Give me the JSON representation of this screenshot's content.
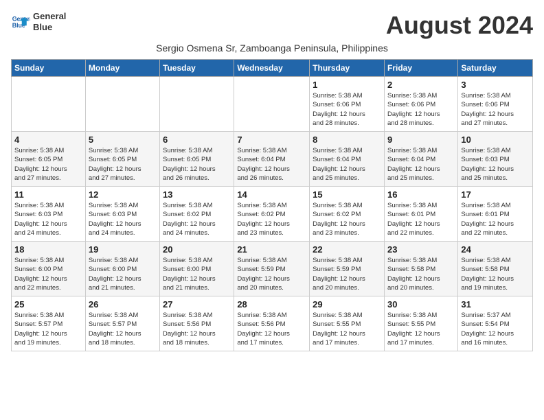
{
  "logo": {
    "line1": "General",
    "line2": "Blue"
  },
  "title": "August 2024",
  "subtitle": "Sergio Osmena Sr, Zamboanga Peninsula, Philippines",
  "days_header": [
    "Sunday",
    "Monday",
    "Tuesday",
    "Wednesday",
    "Thursday",
    "Friday",
    "Saturday"
  ],
  "weeks": [
    [
      {
        "day": "",
        "info": ""
      },
      {
        "day": "",
        "info": ""
      },
      {
        "day": "",
        "info": ""
      },
      {
        "day": "",
        "info": ""
      },
      {
        "day": "1",
        "info": "Sunrise: 5:38 AM\nSunset: 6:06 PM\nDaylight: 12 hours\nand 28 minutes."
      },
      {
        "day": "2",
        "info": "Sunrise: 5:38 AM\nSunset: 6:06 PM\nDaylight: 12 hours\nand 28 minutes."
      },
      {
        "day": "3",
        "info": "Sunrise: 5:38 AM\nSunset: 6:06 PM\nDaylight: 12 hours\nand 27 minutes."
      }
    ],
    [
      {
        "day": "4",
        "info": "Sunrise: 5:38 AM\nSunset: 6:05 PM\nDaylight: 12 hours\nand 27 minutes."
      },
      {
        "day": "5",
        "info": "Sunrise: 5:38 AM\nSunset: 6:05 PM\nDaylight: 12 hours\nand 27 minutes."
      },
      {
        "day": "6",
        "info": "Sunrise: 5:38 AM\nSunset: 6:05 PM\nDaylight: 12 hours\nand 26 minutes."
      },
      {
        "day": "7",
        "info": "Sunrise: 5:38 AM\nSunset: 6:04 PM\nDaylight: 12 hours\nand 26 minutes."
      },
      {
        "day": "8",
        "info": "Sunrise: 5:38 AM\nSunset: 6:04 PM\nDaylight: 12 hours\nand 25 minutes."
      },
      {
        "day": "9",
        "info": "Sunrise: 5:38 AM\nSunset: 6:04 PM\nDaylight: 12 hours\nand 25 minutes."
      },
      {
        "day": "10",
        "info": "Sunrise: 5:38 AM\nSunset: 6:03 PM\nDaylight: 12 hours\nand 25 minutes."
      }
    ],
    [
      {
        "day": "11",
        "info": "Sunrise: 5:38 AM\nSunset: 6:03 PM\nDaylight: 12 hours\nand 24 minutes."
      },
      {
        "day": "12",
        "info": "Sunrise: 5:38 AM\nSunset: 6:03 PM\nDaylight: 12 hours\nand 24 minutes."
      },
      {
        "day": "13",
        "info": "Sunrise: 5:38 AM\nSunset: 6:02 PM\nDaylight: 12 hours\nand 24 minutes."
      },
      {
        "day": "14",
        "info": "Sunrise: 5:38 AM\nSunset: 6:02 PM\nDaylight: 12 hours\nand 23 minutes."
      },
      {
        "day": "15",
        "info": "Sunrise: 5:38 AM\nSunset: 6:02 PM\nDaylight: 12 hours\nand 23 minutes."
      },
      {
        "day": "16",
        "info": "Sunrise: 5:38 AM\nSunset: 6:01 PM\nDaylight: 12 hours\nand 22 minutes."
      },
      {
        "day": "17",
        "info": "Sunrise: 5:38 AM\nSunset: 6:01 PM\nDaylight: 12 hours\nand 22 minutes."
      }
    ],
    [
      {
        "day": "18",
        "info": "Sunrise: 5:38 AM\nSunset: 6:00 PM\nDaylight: 12 hours\nand 22 minutes."
      },
      {
        "day": "19",
        "info": "Sunrise: 5:38 AM\nSunset: 6:00 PM\nDaylight: 12 hours\nand 21 minutes."
      },
      {
        "day": "20",
        "info": "Sunrise: 5:38 AM\nSunset: 6:00 PM\nDaylight: 12 hours\nand 21 minutes."
      },
      {
        "day": "21",
        "info": "Sunrise: 5:38 AM\nSunset: 5:59 PM\nDaylight: 12 hours\nand 20 minutes."
      },
      {
        "day": "22",
        "info": "Sunrise: 5:38 AM\nSunset: 5:59 PM\nDaylight: 12 hours\nand 20 minutes."
      },
      {
        "day": "23",
        "info": "Sunrise: 5:38 AM\nSunset: 5:58 PM\nDaylight: 12 hours\nand 20 minutes."
      },
      {
        "day": "24",
        "info": "Sunrise: 5:38 AM\nSunset: 5:58 PM\nDaylight: 12 hours\nand 19 minutes."
      }
    ],
    [
      {
        "day": "25",
        "info": "Sunrise: 5:38 AM\nSunset: 5:57 PM\nDaylight: 12 hours\nand 19 minutes."
      },
      {
        "day": "26",
        "info": "Sunrise: 5:38 AM\nSunset: 5:57 PM\nDaylight: 12 hours\nand 18 minutes."
      },
      {
        "day": "27",
        "info": "Sunrise: 5:38 AM\nSunset: 5:56 PM\nDaylight: 12 hours\nand 18 minutes."
      },
      {
        "day": "28",
        "info": "Sunrise: 5:38 AM\nSunset: 5:56 PM\nDaylight: 12 hours\nand 17 minutes."
      },
      {
        "day": "29",
        "info": "Sunrise: 5:38 AM\nSunset: 5:55 PM\nDaylight: 12 hours\nand 17 minutes."
      },
      {
        "day": "30",
        "info": "Sunrise: 5:38 AM\nSunset: 5:55 PM\nDaylight: 12 hours\nand 17 minutes."
      },
      {
        "day": "31",
        "info": "Sunrise: 5:37 AM\nSunset: 5:54 PM\nDaylight: 12 hours\nand 16 minutes."
      }
    ]
  ]
}
